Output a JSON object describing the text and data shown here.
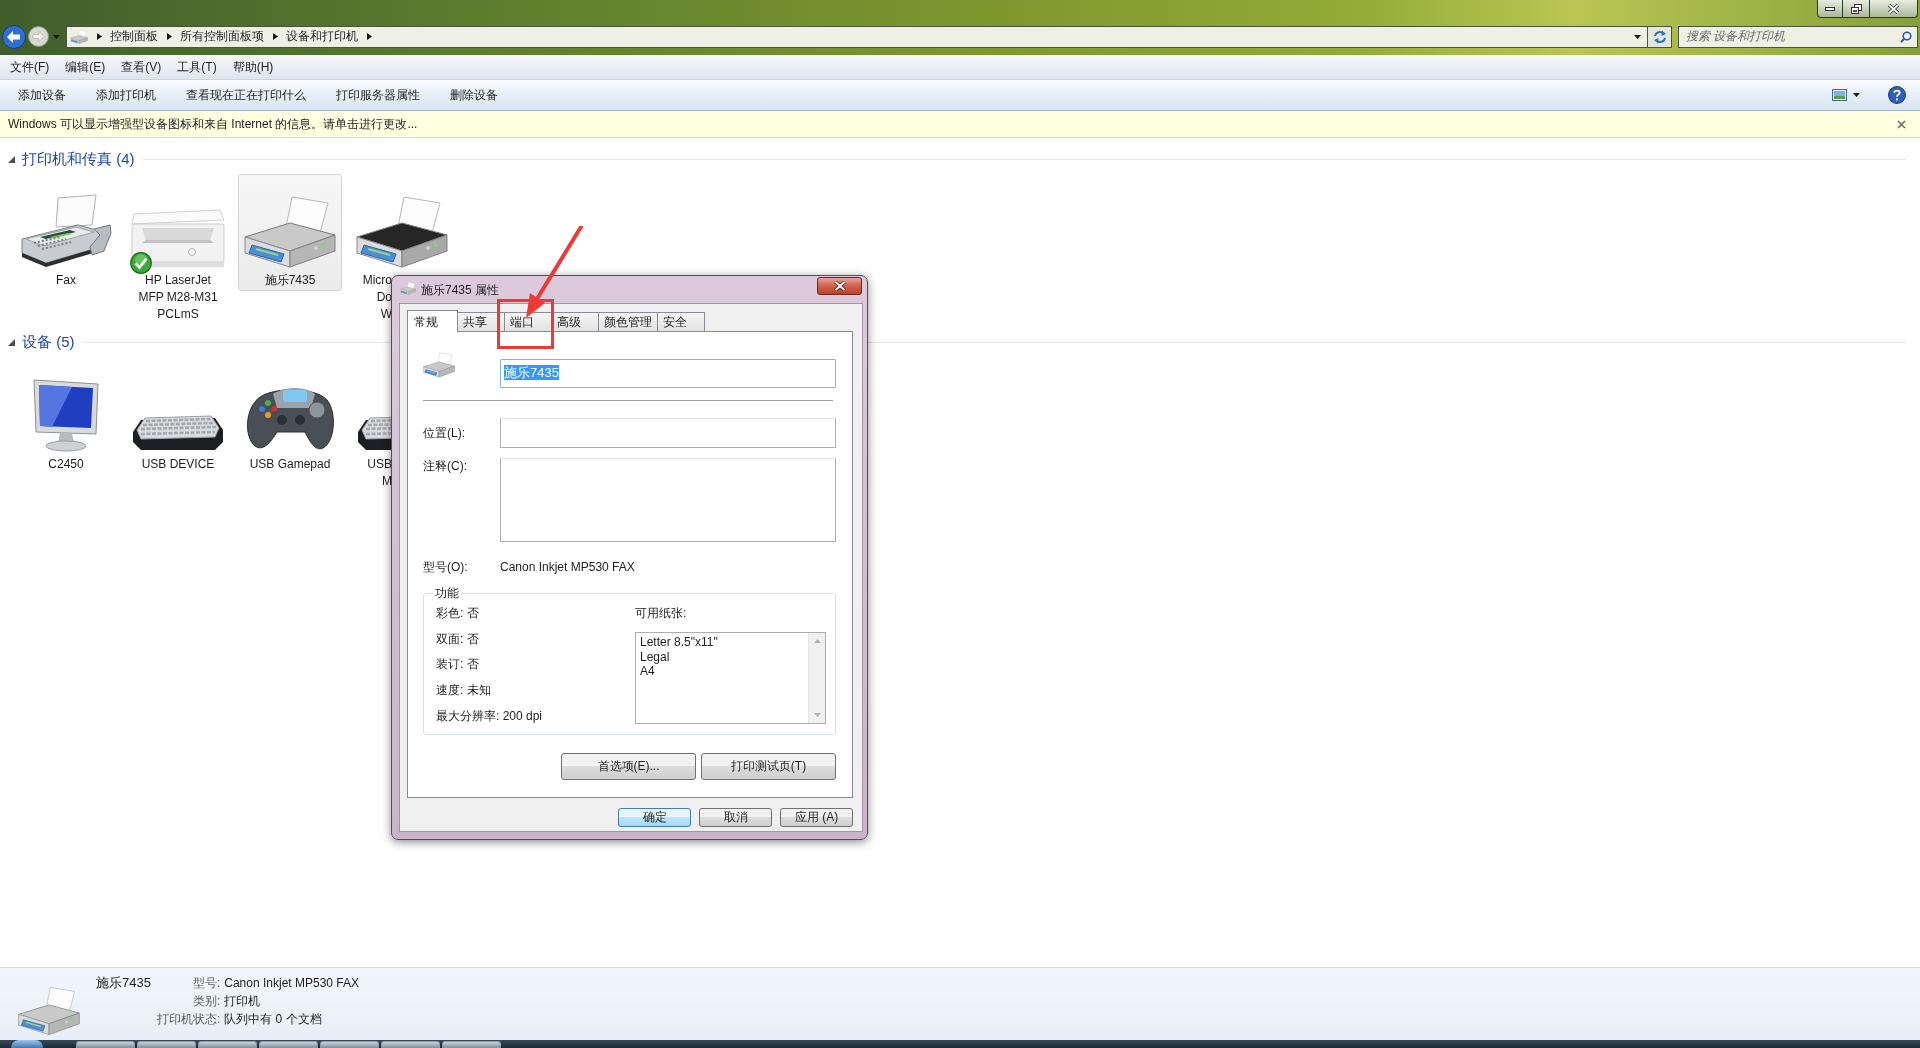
{
  "address_bar": {
    "breadcrumbs": [
      "控制面板",
      "所有控制面板项",
      "设备和打印机"
    ]
  },
  "search": {
    "placeholder": "搜索 设备和打印机"
  },
  "menu": [
    "文件(F)",
    "编辑(E)",
    "查看(V)",
    "工具(T)",
    "帮助(H)"
  ],
  "toolbar": [
    "添加设备",
    "添加打印机",
    "查看现在正在打印什么",
    "打印服务器属性",
    "删除设备"
  ],
  "info_bar": {
    "text": "Windows 可以显示增强型设备图标和来自 Internet 的信息。请单击进行更改..."
  },
  "groups": [
    {
      "title": "打印机和传真 (4)",
      "expanded": true,
      "items": [
        {
          "kind": "fax",
          "label": "Fax",
          "selected": false,
          "default": false
        },
        {
          "kind": "mfp",
          "label": "HP LaserJet\nMFP M28-M31\nPCLmS",
          "selected": false,
          "default": true
        },
        {
          "kind": "printer",
          "label": "施乐7435",
          "selected": true,
          "default": false
        },
        {
          "kind": "docprinter",
          "label": "Micro\nDo\nW",
          "selected": false,
          "default": false
        }
      ]
    },
    {
      "title": "设备 (5)",
      "expanded": true,
      "items": [
        {
          "kind": "monitor",
          "label": "C2450",
          "selected": false,
          "default": false
        },
        {
          "kind": "keyboard",
          "label": "USB DEVICE",
          "selected": false,
          "default": false
        },
        {
          "kind": "gamepad",
          "label": "USB Gamepad",
          "selected": false,
          "default": false
        },
        {
          "kind": "keyboard",
          "label": "USB\nM",
          "selected": false,
          "default": false
        }
      ]
    }
  ],
  "dialog": {
    "title": "施乐7435 属性",
    "tabs": [
      {
        "label": "常规",
        "selected": true,
        "marked": false
      },
      {
        "label": "共享",
        "selected": false,
        "marked": false
      },
      {
        "label": "端口",
        "selected": false,
        "marked": true
      },
      {
        "label": "高级",
        "selected": false,
        "marked": false
      },
      {
        "label": "颜色管理",
        "selected": false,
        "marked": false
      },
      {
        "label": "安全",
        "selected": false,
        "marked": false
      }
    ],
    "name_field": {
      "value": "施乐7435",
      "selected_text": true
    },
    "location": {
      "label": "位置(L):"
    },
    "comment": {
      "label": "注释(C):"
    },
    "model": {
      "label": "型号(O):",
      "value": "Canon Inkjet MP530 FAX"
    },
    "features": {
      "title": "功能",
      "items": [
        "彩色: 否",
        "双面: 否",
        "装订: 否",
        "速度: 未知",
        "最大分辨率: 200 dpi"
      ],
      "paper_label": "可用纸张:",
      "papers": [
        "Letter 8.5\"x11\"",
        "Legal",
        "A4"
      ]
    },
    "action_buttons": [
      "首选项(E)...",
      "打印测试页(T)"
    ],
    "buttons": [
      {
        "label": "确定",
        "default": true
      },
      {
        "label": "取消",
        "default": false
      },
      {
        "label": "应用 (A)",
        "default": false
      }
    ]
  },
  "details": {
    "name": "施乐7435",
    "fields": [
      {
        "label": "型号:",
        "value": "Canon Inkjet MP530 FAX"
      },
      {
        "label": "类别:",
        "value": "打印机"
      },
      {
        "label": "打印机状态:",
        "value": "队列中有 0 个文档"
      }
    ]
  }
}
